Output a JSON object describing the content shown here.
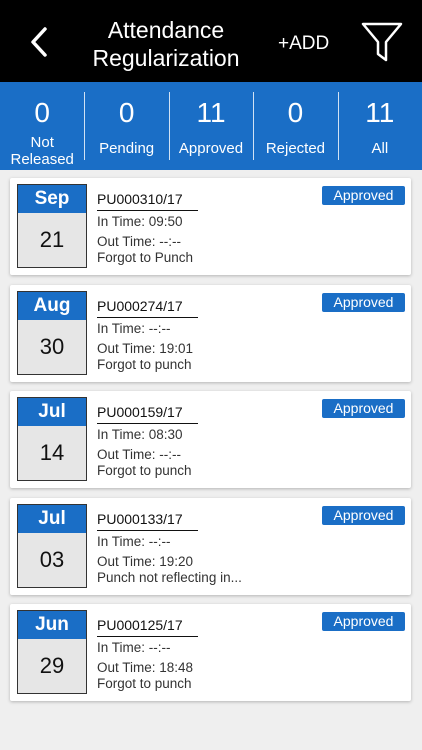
{
  "header": {
    "title_line1": "Attendance",
    "title_line2": "Regularization",
    "add_label": "+ADD"
  },
  "stats": [
    {
      "count": "0",
      "label_line1": "Not",
      "label_line2": "Released"
    },
    {
      "count": "0",
      "label": "Pending"
    },
    {
      "count": "11",
      "label": "Approved"
    },
    {
      "count": "0",
      "label": "Rejected"
    },
    {
      "count": "11",
      "label": "All"
    }
  ],
  "records": [
    {
      "month": "Sep",
      "day": "21",
      "code": "PU000310/17",
      "in_time": "In Time: 09:50",
      "out_time": "Out Time: --:--",
      "reason": "Forgot to Punch",
      "status": "Approved"
    },
    {
      "month": "Aug",
      "day": "30",
      "code": "PU000274/17",
      "in_time": "In Time: --:--",
      "out_time": "Out Time: 19:01",
      "reason": "Forgot to punch",
      "status": "Approved"
    },
    {
      "month": "Jul",
      "day": "14",
      "code": "PU000159/17",
      "in_time": "In Time: 08:30",
      "out_time": "Out Time: --:--",
      "reason": "Forgot to punch",
      "status": "Approved"
    },
    {
      "month": "Jul",
      "day": "03",
      "code": "PU000133/17",
      "in_time": "In Time: --:--",
      "out_time": "Out Time: 19:20",
      "reason": "Punch not reflecting in...",
      "status": "Approved"
    },
    {
      "month": "Jun",
      "day": "29",
      "code": "PU000125/17",
      "in_time": "In Time: --:--",
      "out_time": "Out Time: 18:48",
      "reason": "Forgot to punch",
      "status": "Approved"
    }
  ],
  "colors": {
    "primary": "#1a6ec6",
    "header_bg": "#000000"
  },
  "icons": {
    "back": "chevron-left-icon",
    "filter": "filter-icon"
  }
}
